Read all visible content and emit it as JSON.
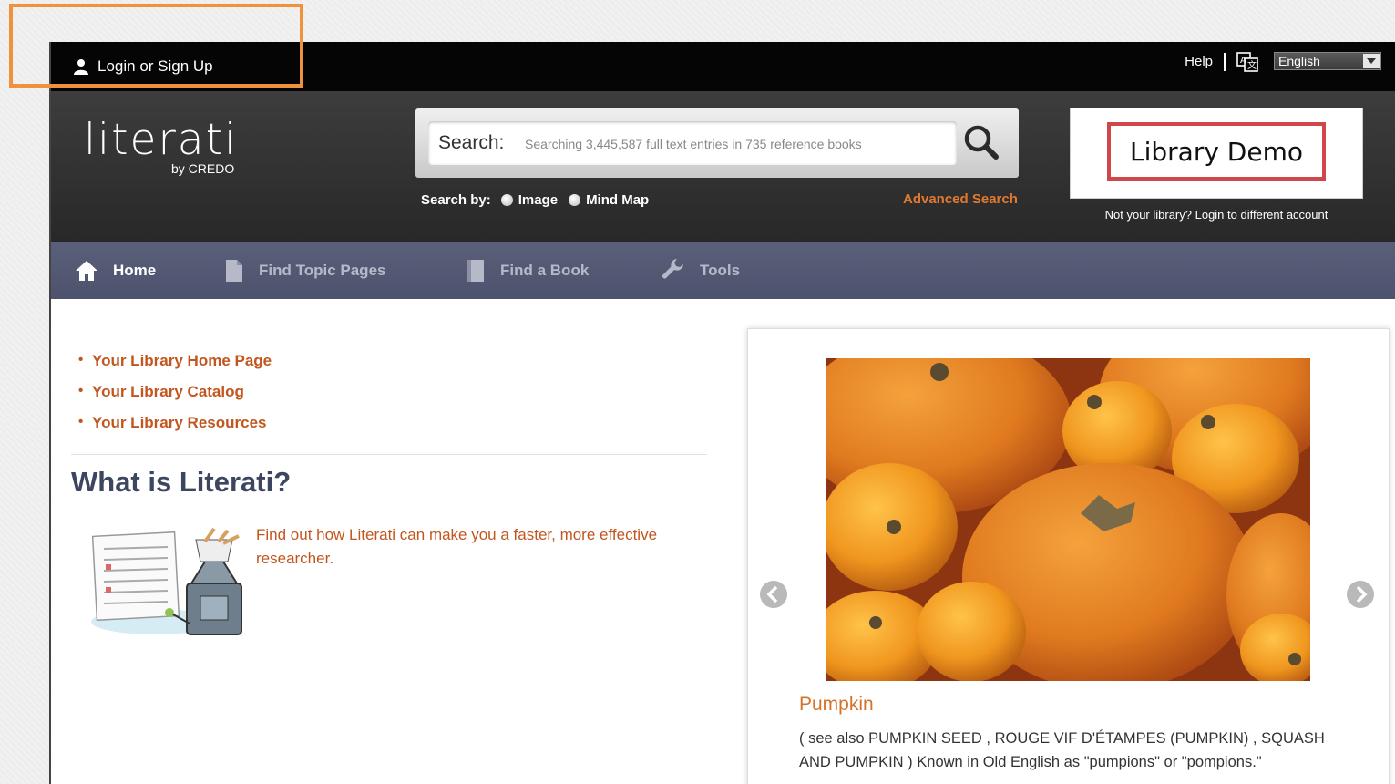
{
  "topbar": {
    "login_label": "Login or Sign Up",
    "help_label": "Help",
    "language": "English"
  },
  "header": {
    "logo_main": "literati",
    "logo_sub": "by CREDO",
    "search_label": "Search:",
    "search_placeholder": "Searching 3,445,587 full text entries in 735 reference books",
    "search_by_label": "Search by:",
    "search_by_options": [
      "Image",
      "Mind Map"
    ],
    "advanced_search": "Advanced Search",
    "library_name": "Library Demo",
    "not_your_library": "Not your library? Login to different account"
  },
  "nav": {
    "items": [
      {
        "label": "Home",
        "icon": "home-icon",
        "active": true
      },
      {
        "label": "Find Topic Pages",
        "icon": "document-icon",
        "active": false
      },
      {
        "label": "Find a Book",
        "icon": "book-icon",
        "active": false
      },
      {
        "label": "Tools",
        "icon": "wrench-icon",
        "active": false
      }
    ]
  },
  "main": {
    "links": [
      "Your Library Home Page",
      "Your Library Catalog",
      "Your Library Resources"
    ],
    "heading": "What is Literati?",
    "description": "Find out how Literati can make you a faster, more effective researcher."
  },
  "carousel": {
    "title": "Pumpkin",
    "text": "( see also PUMPKIN SEED , ROUGE VIF D'ÉTAMPES (PUMPKIN) , SQUASH AND PUMPKIN ) Known in Old English as \"pumpions\" or \"pompions.\""
  },
  "colors": {
    "accent_orange": "#c2561f",
    "nav_bg": "#555a74",
    "annotation": "#f0923a",
    "library_border": "#d0464b"
  }
}
